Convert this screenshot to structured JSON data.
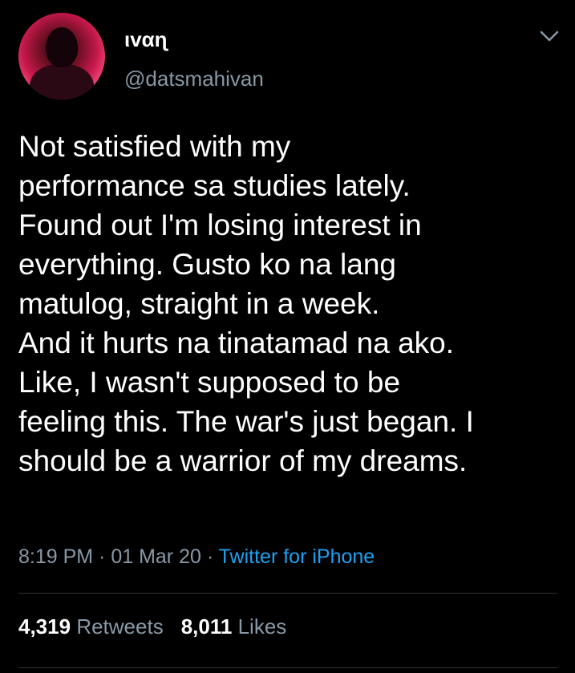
{
  "user": {
    "display_name": "ιvαɳ",
    "handle": "@datsmahivan"
  },
  "tweet": {
    "text": "Not satisfied with my\nperformance sa studies lately.\nFound out I'm losing interest in\neverything. Gusto ko na lang\nmatulog, straight in a week.\nAnd it hurts na tinatamad na ako.\nLike, I wasn't supposed to be\nfeeling this. The war's just began. I\nshould be a warrior of my dreams.",
    "time": "8:19 PM",
    "separator": " · ",
    "date": "01 Mar 20",
    "source": "Twitter for iPhone"
  },
  "stats": {
    "retweets_count": "4,319",
    "retweets_label": "Retweets",
    "likes_count": "8,011",
    "likes_label": "Likes"
  },
  "icons": {
    "menu": "chevron-down-icon"
  },
  "colors": {
    "background": "#000000",
    "secondary_text": "#8899a6",
    "accent": "#1da1f2",
    "divider": "#2f3336"
  }
}
